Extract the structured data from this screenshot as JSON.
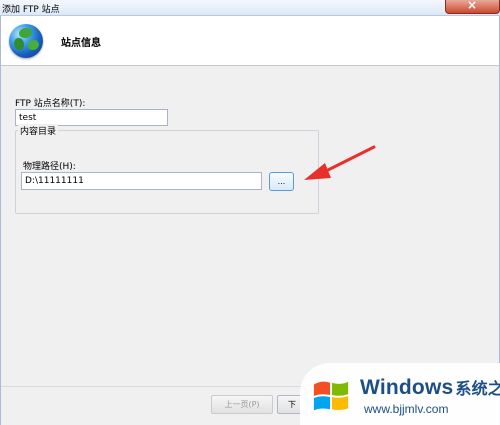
{
  "window": {
    "title": "添加 FTP 站点"
  },
  "header": {
    "title": "站点信息"
  },
  "form": {
    "site_name_label": "FTP 站点名称(T):",
    "site_name_value": "test",
    "group_title": "内容目录",
    "physical_path_label": "物理路径(H):",
    "physical_path_value": "D:\\11111111",
    "browse_label": "..."
  },
  "buttons": {
    "previous_label": "上一页(P)",
    "next_label": "下"
  },
  "watermark": {
    "brand": "Windows",
    "brand_cn": "系统之家",
    "url": "www.bjjmlv.com"
  },
  "colors": {
    "accent": "#5a9bd8",
    "arrow": "#e8302a",
    "watermark_text": "#1d4f86"
  },
  "icons": {
    "header": "globe-icon",
    "annotation": "red-arrow-icon",
    "watermark": "windows-logo-icon"
  }
}
